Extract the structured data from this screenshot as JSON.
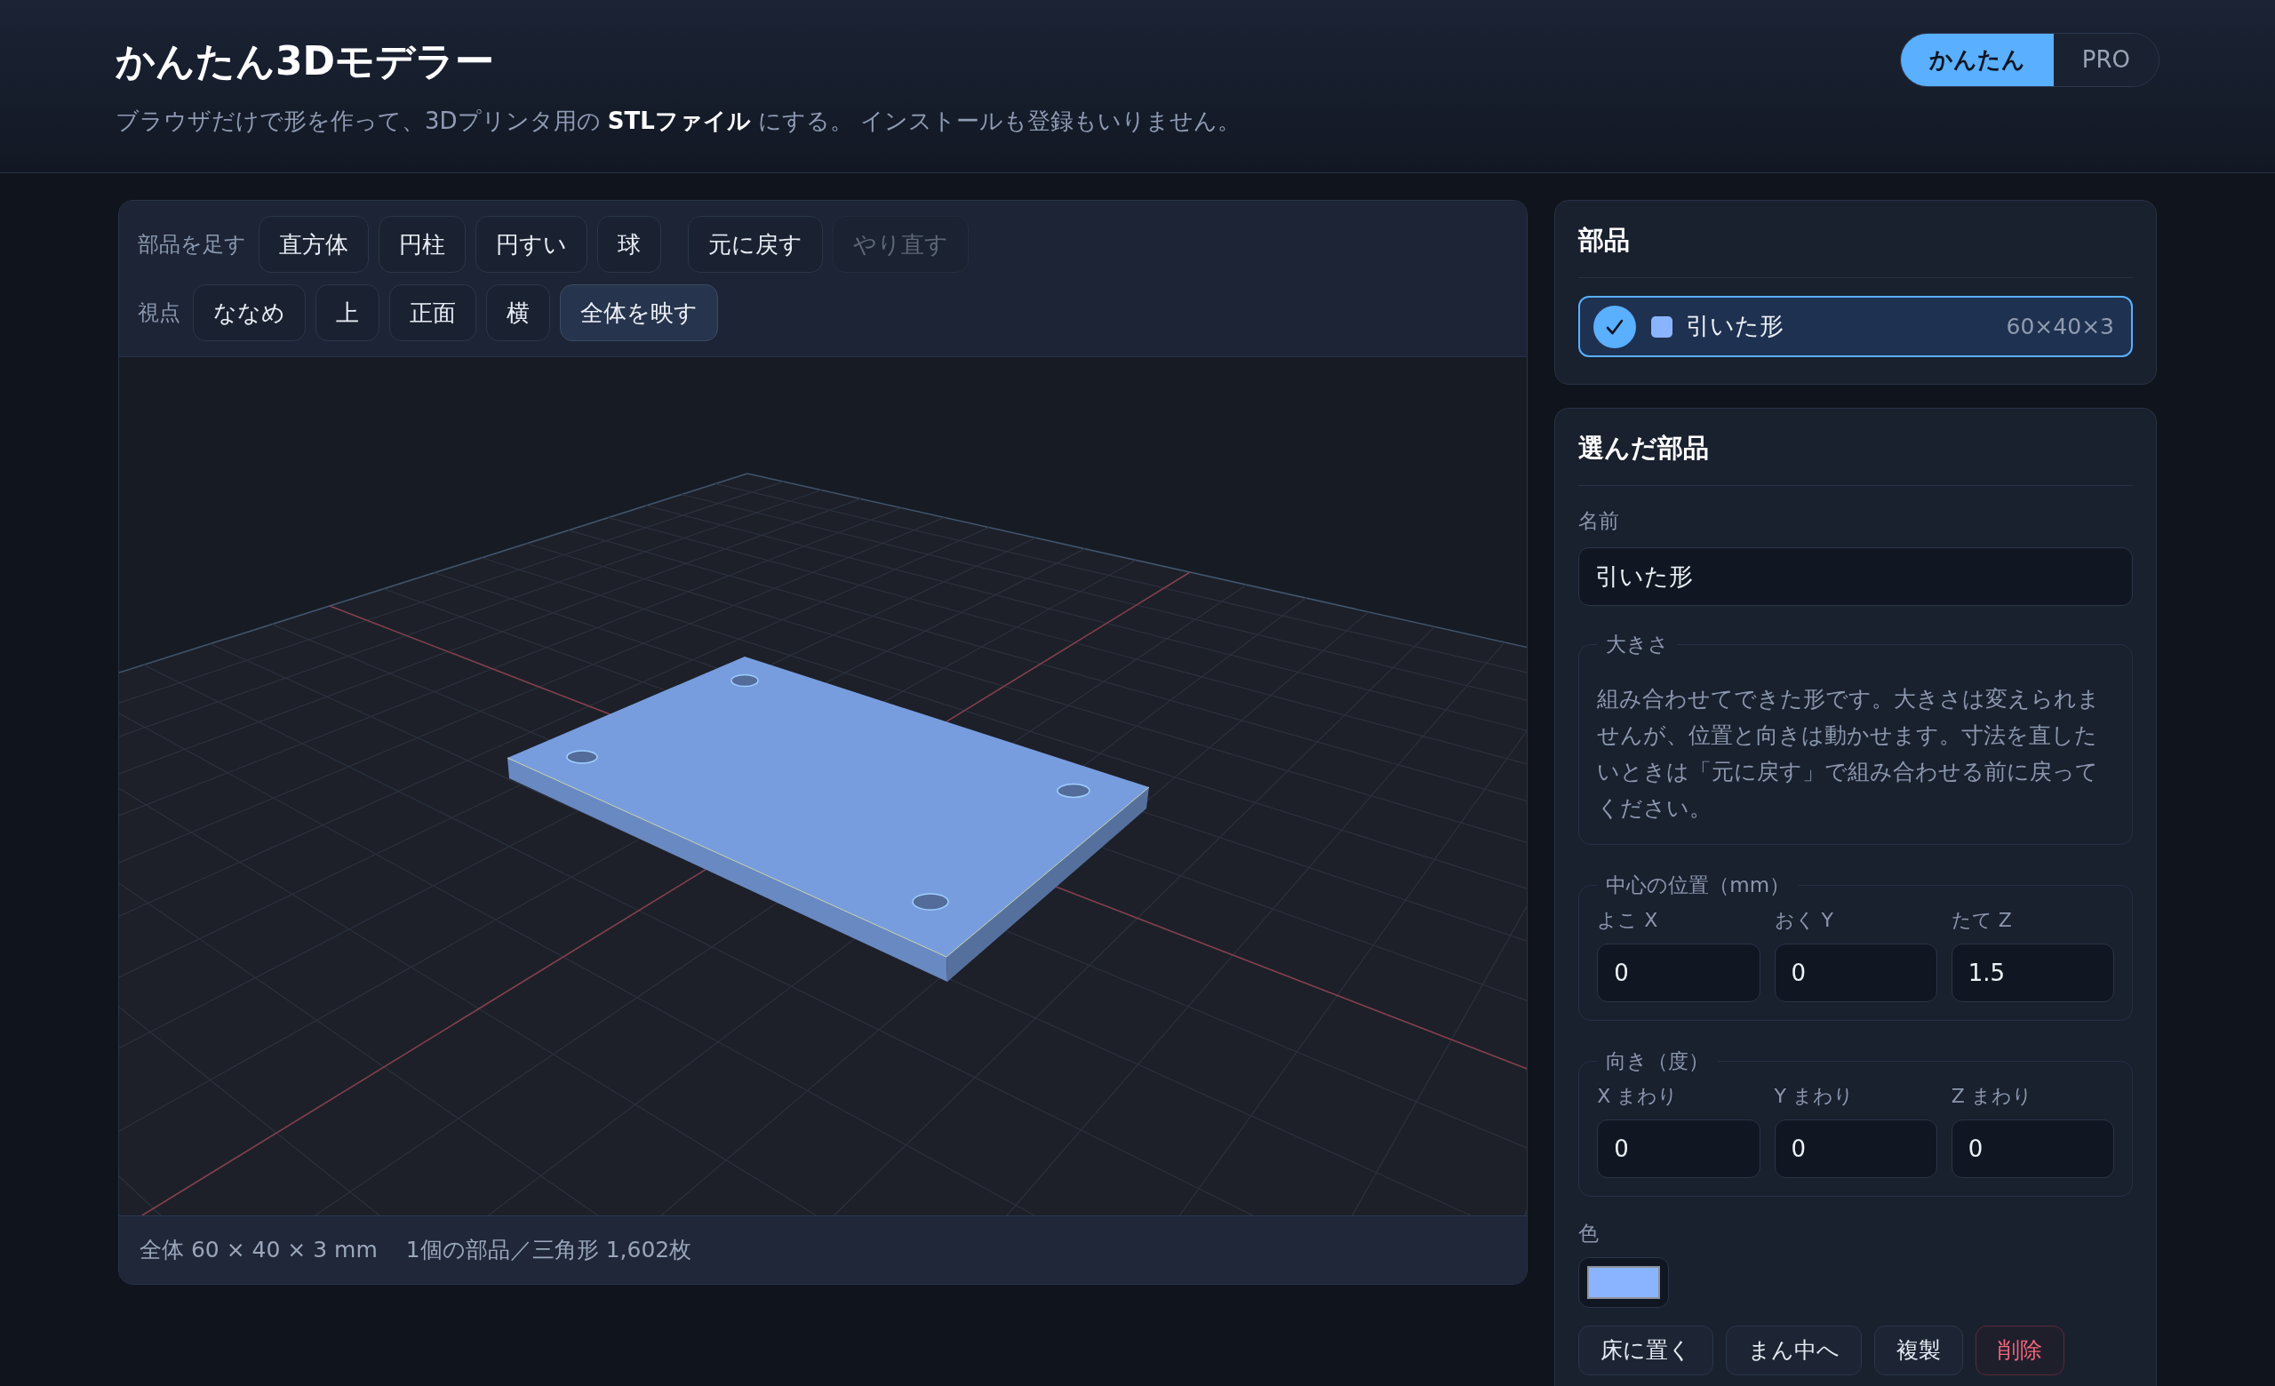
{
  "header": {
    "title": "かんたん3Dモデラー",
    "subtitle": "ブラウザだけで形を作って、3Dプリンタ用の **STLファイル** にする。 インストールも登録もいりません。"
  },
  "mode_tabs": [
    {
      "label": "かんたん",
      "selected": true
    },
    {
      "label": "PRO",
      "selected": false
    }
  ],
  "toolbar": [
    {
      "label": "部品を足す",
      "groups": [
        {
          "buttons": [
            {
              "label": "直方体",
              "kind": "plain",
              "disabled": false
            },
            {
              "label": "円柱",
              "kind": "plain",
              "disabled": false
            },
            {
              "label": "円すい",
              "kind": "plain",
              "disabled": false
            },
            {
              "label": "球",
              "kind": "plain",
              "disabled": false
            }
          ]
        },
        {
          "buttons": [
            {
              "label": "元に戻す",
              "kind": "plain",
              "disabled": false
            },
            {
              "label": "やり直す",
              "kind": "plain",
              "disabled": true
            }
          ]
        }
      ]
    },
    {
      "label": "視点",
      "groups": [
        {
          "buttons": [
            {
              "label": "ななめ",
              "kind": "plain",
              "disabled": false
            },
            {
              "label": "上",
              "kind": "plain",
              "disabled": false
            },
            {
              "label": "正面",
              "kind": "plain",
              "disabled": false
            },
            {
              "label": "横",
              "kind": "plain",
              "disabled": false
            },
            {
              "label": "全体を映す",
              "kind": "accent",
              "disabled": false
            }
          ]
        }
      ]
    }
  ],
  "status_bar": [
    "全体 60 × 40 × 3 mm",
    "1個の部品／三角形 1,602枚"
  ],
  "parts_panel": {
    "title": "部品",
    "items": [
      {
        "name": "引いた形",
        "size": "60×40×3",
        "color": "#8ab4ff",
        "selected": true
      }
    ]
  },
  "selected_part": {
    "title": "選んだ部品",
    "name": {
      "label": "名前",
      "value": "引いた形"
    },
    "size": {
      "legend": "大きさ",
      "note": "組み合わせてできた形です。大きさは変えられませんが、位置と向きは動かせます。寸法を直したいときは「元に戻す」で組み合わせる前に戻ってください。"
    },
    "position": {
      "legend": "中心の位置（mm）",
      "fields": [
        {
          "label": "よこ X",
          "value": "0"
        },
        {
          "label": "おく Y",
          "value": "0"
        },
        {
          "label": "たて Z",
          "value": "1.5"
        }
      ]
    },
    "rotation": {
      "legend": "向き（度）",
      "fields": [
        {
          "label": "X まわり",
          "value": "0"
        },
        {
          "label": "Y まわり",
          "value": "0"
        },
        {
          "label": "Z まわり",
          "value": "0"
        }
      ]
    },
    "color": {
      "label": "色"
    },
    "actions": [
      {
        "label": "床に置く",
        "kind": "plain"
      },
      {
        "label": "まん中へ",
        "kind": "plain"
      },
      {
        "label": "複製",
        "kind": "plain"
      },
      {
        "label": "削除",
        "kind": "danger"
      }
    ]
  }
}
